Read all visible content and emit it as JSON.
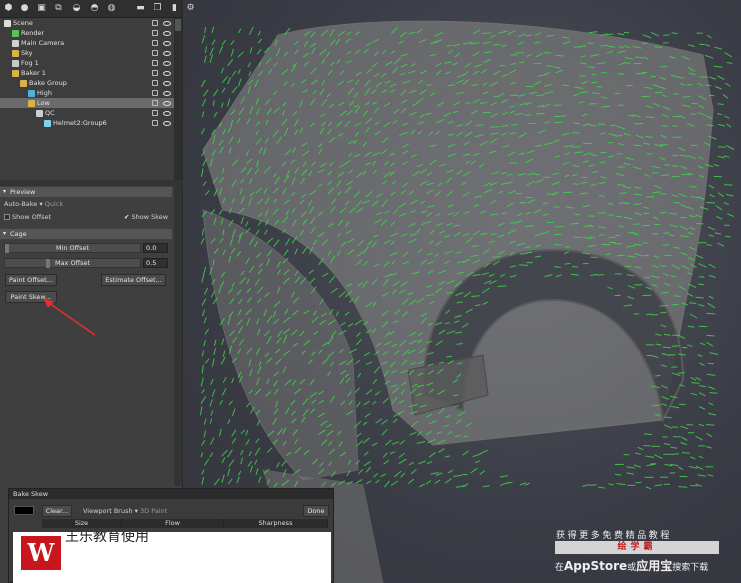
{
  "toolbar": {
    "icons": [
      "scene-icon",
      "light-icon",
      "camera-icon",
      "bake-icon",
      "material-icon",
      "sky-icon",
      "folder-icon",
      "duplicate-icon",
      "delete-icon",
      "settings-icon"
    ]
  },
  "tree": {
    "items": [
      {
        "label": "Scene",
        "icon": "scene-icon",
        "color": "#dddddd",
        "selected": false
      },
      {
        "label": "Render",
        "icon": "render-icon",
        "color": "#58c458",
        "selected": false
      },
      {
        "label": "Main Camera",
        "icon": "camera-icon",
        "color": "#cfcfcf",
        "selected": false
      },
      {
        "label": "Sky",
        "icon": "sky-icon",
        "color": "#d9b24a",
        "selected": false
      },
      {
        "label": "Fog 1",
        "icon": "fog-icon",
        "color": "#c9c9c9",
        "selected": false
      },
      {
        "label": "Baker 1",
        "icon": "baker-icon",
        "color": "#d9b24a",
        "selected": false
      },
      {
        "label": "Bake Group",
        "icon": "folder-icon",
        "color": "#d9b24a",
        "selected": false
      },
      {
        "label": "High",
        "icon": "mesh-icon",
        "color": "#4fb0e6",
        "selected": false
      },
      {
        "label": "Low",
        "icon": "mesh-icon",
        "color": "#d9b24a",
        "selected": true
      },
      {
        "label": "QC",
        "icon": "mesh-icon",
        "color": "#cfcfcf",
        "selected": false
      },
      {
        "label": "Helmet2:Group6",
        "icon": "mesh-icon",
        "color": "#7fd1e8",
        "selected": false
      }
    ]
  },
  "preview": {
    "header": "Preview",
    "auto_bake_label": "Auto-Bake",
    "auto_bake_value": "Quick",
    "show_offset": "Show Offset",
    "show_skew": "Show Skew"
  },
  "cage": {
    "header": "Cage",
    "min_offset_label": "Min Offset",
    "min_offset_value": "0.0",
    "max_offset_label": "Max Offset",
    "max_offset_value": "0.5",
    "paint_offset": "Paint Offset...",
    "estimate_offset": "Estimate Offset...",
    "paint_skew": "Paint Skew..."
  },
  "bake_skew": {
    "title": "Bake Skew",
    "clear": "Clear...",
    "viewport_brush": "Viewport Brush",
    "paint_mode": "3D Paint",
    "done": "Done",
    "columns": [
      "Size",
      "Flow",
      "Sharpness"
    ]
  },
  "overlay": {
    "logo_letter": "W",
    "text": "王乐教育使用"
  },
  "watermark": {
    "top": "获得更多免费精品教程",
    "bar": "绘学霸",
    "bottom_pre": "在",
    "bottom_big": "AppStore",
    "bottom_mid": "或",
    "bottom_big2": "应用宝",
    "bottom_post": "搜索下载"
  },
  "colors": {
    "accent_arrow": "#e0302b",
    "skew_green": "#3fd34a",
    "mesh_gray": "#8a8a8a"
  }
}
